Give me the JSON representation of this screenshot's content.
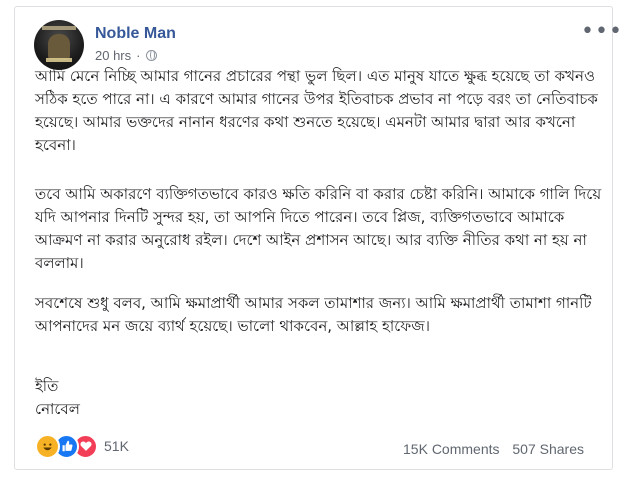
{
  "post": {
    "author": "Noble Man",
    "time": "20 hrs",
    "separator": "·",
    "privacy_icon": "globe-icon",
    "more_icon": "more-options-icon",
    "paragraphs": [
      "আমি মেনে নিচ্ছি আমার গানের প্রচারের পন্থা ভুল ছিল। এত মানুষ যাতে ক্ষুব্ধ হয়েছে তা কখনও সঠিক হতে পারে না। এ কারণে আমার গানের উপর ইতিবাচক প্রভাব না পড়ে বরং তা নেতিবাচক হয়েছে। আমার ভক্তদের নানান ধরণের কথা শুনতে হয়েছে। এমনটা আমার দ্বারা আর কখনো হবেনা।",
      "তবে আমি অকারণে ব্যক্তিগতভাবে কারও ক্ষতি করিনি বা করার চেষ্টা করিনি। আমাকে গালি দিয়ে যদি আপনার দিনটি সুন্দর হয়, তা আপনি দিতে পারেন। তবে প্লিজ, ব্যক্তিগতভাবে আমাকে আক্রমণ না করার অনুরোধ রইল। দেশে আইন প্রশাসন আছে। আর ব্যক্তি নীতির কথা না হয় না বললাম।",
      "সবশেষে শুধু বলব, আমি ক্ষমাপ্রার্থী আমার সকল তামাশার জন্য। আমি ক্ষমাপ্রার্থী তামাশা গানটি আপনাদের মন জয়ে ব্যার্থ হয়েছে। ভালো থাকবেন, আল্লাহ হাফেজ।"
    ],
    "signoff": [
      "ইতি",
      "নোবেল"
    ]
  },
  "footer": {
    "reaction_icons": [
      "haha-reaction-icon",
      "like-reaction-icon",
      "love-reaction-icon"
    ],
    "reaction_count": "51K",
    "comments": "15K Comments",
    "shares": "507 Shares"
  },
  "colors": {
    "author": "#365899",
    "meta": "#616770",
    "text": "#1c1e21",
    "like": "#1877f2",
    "love": "#f33e58",
    "haha": "#f7b125"
  }
}
